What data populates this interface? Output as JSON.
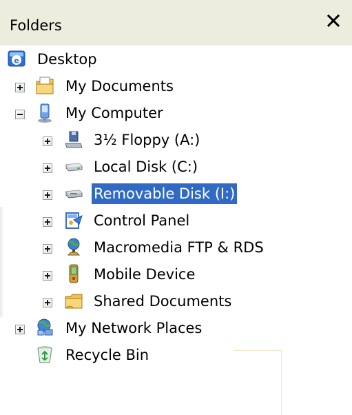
{
  "header": {
    "title": "Folders",
    "close_glyph": "×"
  },
  "tree": {
    "items": [
      {
        "label": "Desktop",
        "icon": "desktop-icon",
        "expander": "none",
        "selected": false
      },
      {
        "label": "My Documents",
        "icon": "my-documents-icon",
        "expander": "plus",
        "selected": false
      },
      {
        "label": "My Computer",
        "icon": "my-computer-icon",
        "expander": "minus",
        "selected": false
      },
      {
        "label": "3½ Floppy (A:)",
        "icon": "floppy-drive-icon",
        "expander": "plus",
        "selected": false
      },
      {
        "label": "Local Disk (C:)",
        "icon": "hard-disk-icon",
        "expander": "plus",
        "selected": false
      },
      {
        "label": "Removable Disk (I:)",
        "icon": "removable-disk-icon",
        "expander": "plus",
        "selected": true
      },
      {
        "label": "Control Panel",
        "icon": "control-panel-icon",
        "expander": "plus",
        "selected": false
      },
      {
        "label": "Macromedia FTP & RDS",
        "icon": "macromedia-ftp-icon",
        "expander": "plus",
        "selected": false
      },
      {
        "label": "Mobile Device",
        "icon": "mobile-device-icon",
        "expander": "plus",
        "selected": false
      },
      {
        "label": "Shared Documents",
        "icon": "shared-folder-icon",
        "expander": "plus",
        "selected": false
      },
      {
        "label": "My Network Places",
        "icon": "network-places-icon",
        "expander": "plus",
        "selected": false
      },
      {
        "label": "Recycle Bin",
        "icon": "recycle-bin-icon",
        "expander": "none",
        "selected": false
      }
    ]
  },
  "colors": {
    "header_bg": "#ededde",
    "selection_bg": "#316ac5",
    "selection_text": "#ffffff"
  }
}
